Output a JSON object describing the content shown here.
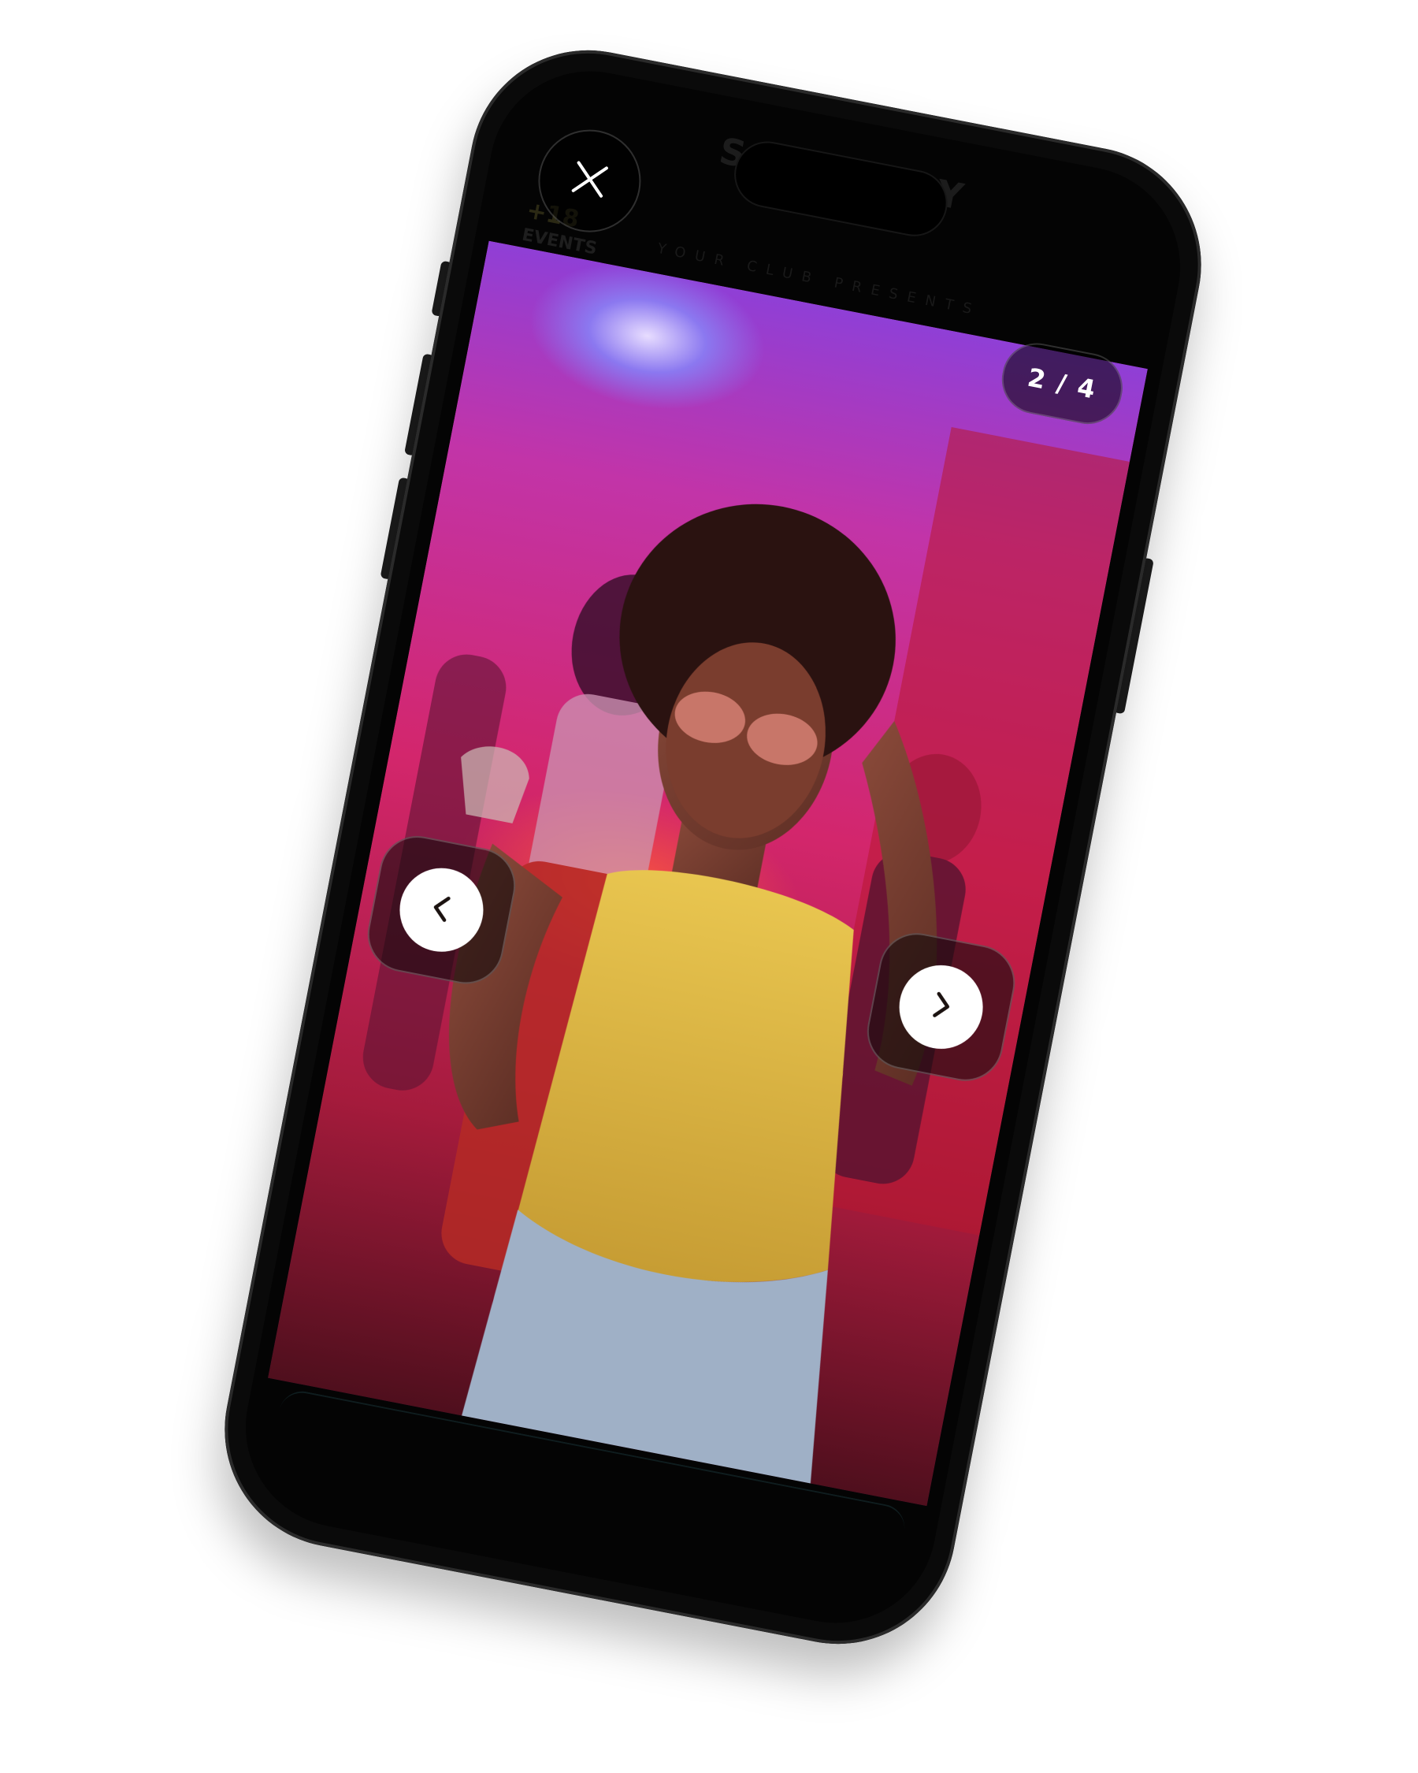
{
  "lightbox": {
    "counter": "2 / 4",
    "current_index": 2,
    "total": 4
  },
  "underlying_page": {
    "title": "SATURDAY",
    "age_badge": "+18",
    "age_badge_caption": "EVENTS",
    "presents_text": "YOUR CLUB PRESENTS"
  },
  "icons": {
    "close": "close-icon",
    "prev": "chevron-left-icon",
    "next": "chevron-right-icon"
  },
  "colors": {
    "frame": "#0a0a0a",
    "control_bg": "#000000",
    "control_fg": "#ffffff",
    "photo_magenta": "#d1246a",
    "photo_purple": "#8b47d9",
    "tank_top_yellow": "#e8c44f"
  }
}
